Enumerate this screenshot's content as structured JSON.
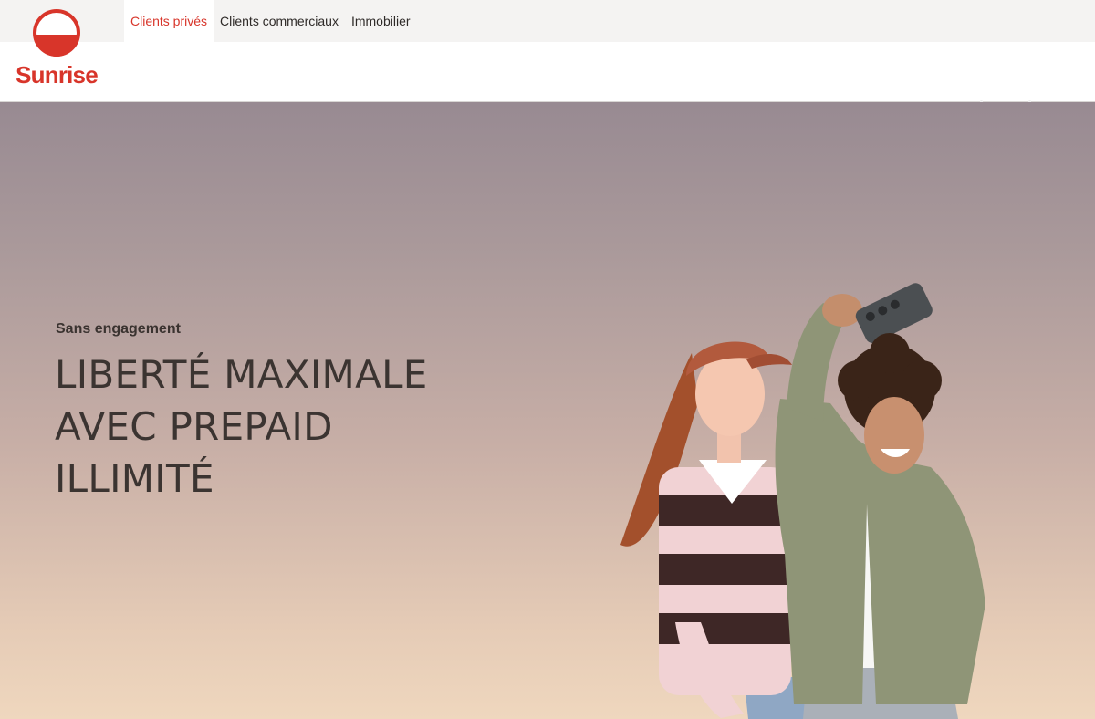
{
  "brand": {
    "name": "Sunrise",
    "color": "#d8352a"
  },
  "segments": [
    {
      "label": "Clients privés",
      "active": true
    },
    {
      "label": "Clients commerciaux",
      "active": false
    },
    {
      "label": "Immobilier",
      "active": false
    }
  ],
  "hero": {
    "eyebrow": "Sans engagement",
    "headline_lines": [
      "LIBERTÉ MAXIMALE",
      "AVEC PREPAID",
      "ILLIMITÉ"
    ]
  }
}
